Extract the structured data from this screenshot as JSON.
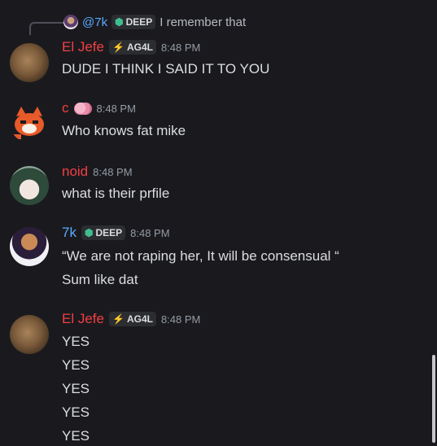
{
  "reply": {
    "name": "@7k",
    "badge": "DEEP",
    "text": "I remember that"
  },
  "messages": [
    {
      "author": "El Jefe",
      "badge": "AG4L",
      "time": "8:48 PM",
      "lines": [
        "DUDE I THINK I SAID IT TO YOU"
      ]
    },
    {
      "author": "c",
      "time": "8:48 PM",
      "lines": [
        "Who knows fat mike"
      ]
    },
    {
      "author": "noid",
      "time": "8:48 PM",
      "lines": [
        "what is their prfile"
      ]
    },
    {
      "author": "7k",
      "badge": "DEEP",
      "time": "8:48 PM",
      "lines": [
        "“We are not raping her, It will be consensual “",
        "Sum like dat"
      ]
    },
    {
      "author": "El Jefe",
      "badge": "AG4L",
      "time": "8:48 PM",
      "lines": [
        "YES",
        "YES",
        "YES",
        "YES",
        "YES"
      ]
    }
  ],
  "colors": {
    "background": "#1a1a1e",
    "name_red": "#f23f43",
    "name_blue": "#5aa9ff",
    "text": "#dbdee1",
    "muted": "#949ba4"
  },
  "icons": {
    "deep_badge": "shield-icon",
    "ag4l_badge": "lightning-icon",
    "c_badge": "brain-icon"
  }
}
